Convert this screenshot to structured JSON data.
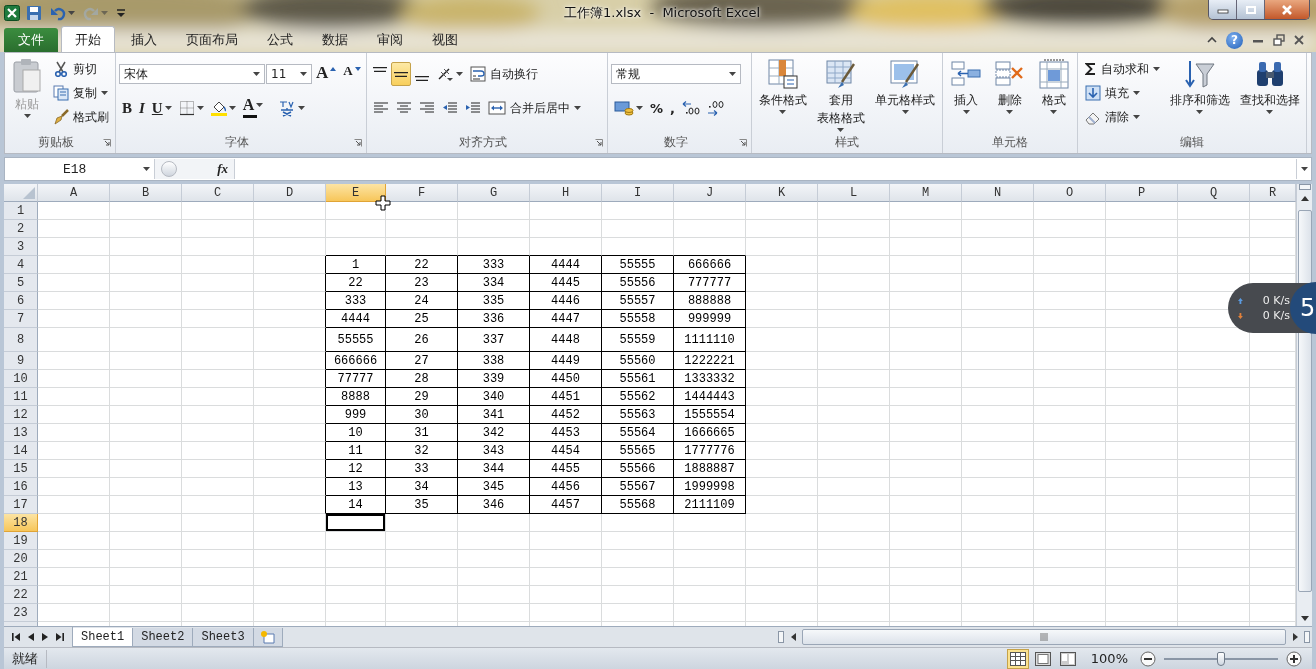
{
  "window": {
    "title": "工作簿1.xlsx  -  Microsoft Excel"
  },
  "quick_access": [
    {
      "disabled": false,
      "dropdown": false
    },
    {
      "disabled": false,
      "dropdown": true
    },
    {
      "disabled": true,
      "dropdown": true
    },
    {
      "disabled": false,
      "dropdown": false
    }
  ],
  "ribbon": {
    "tabs": [
      {
        "label": "文件",
        "kind": "backstage",
        "selected": false
      },
      {
        "label": "开始",
        "kind": "tab",
        "selected": true
      },
      {
        "label": "插入",
        "kind": "tab",
        "selected": false
      },
      {
        "label": "页面布局",
        "kind": "tab",
        "selected": false
      },
      {
        "label": "公式",
        "kind": "tab",
        "selected": false
      },
      {
        "label": "数据",
        "kind": "tab",
        "selected": false
      },
      {
        "label": "审阅",
        "kind": "tab",
        "selected": false
      },
      {
        "label": "视图",
        "kind": "tab",
        "selected": false
      }
    ],
    "help": "?",
    "groups": [
      {
        "title": "剪贴板",
        "launcher": true,
        "items": [
          {
            "kind": "large",
            "lines": [
              "粘贴"
            ],
            "disabled": true,
            "dropdown": true
          },
          {
            "kind": "column",
            "items": [
              {
                "label": "剪切",
                "dropdown": false
              },
              {
                "label": "复制",
                "dropdown": true
              },
              {
                "label": "格式刷",
                "dropdown": false
              }
            ]
          }
        ]
      },
      {
        "title": "字体",
        "launcher": true,
        "items": [
          {
            "kind": "toolbar",
            "upper": [
              {
                "kind": "combo",
                "value": "宋体"
              },
              {
                "kind": "combo",
                "value": "11"
              },
              {
                "kind": "glyph",
                "label": "A",
                "dropdown": false,
                "selected": false
              },
              {
                "kind": "glyph",
                "label": "A",
                "dropdown": false,
                "selected": false
              }
            ],
            "lower": [
              {
                "kind": "glyph",
                "label": "B",
                "dropdown": false,
                "selected": false
              },
              {
                "kind": "glyph",
                "label": "I",
                "dropdown": false,
                "selected": false
              },
              {
                "kind": "glyph",
                "label": "U",
                "dropdown": true,
                "selected": false
              },
              {
                "kind": "icon",
                "dropdown": true,
                "selected": false
              },
              {
                "kind": "icon",
                "dropdown": true,
                "selected": false
              },
              {
                "kind": "glyph",
                "label": "A",
                "dropdown": true,
                "selected": false
              },
              {
                "kind": "icon",
                "dropdown": true,
                "selected": false
              }
            ]
          }
        ]
      },
      {
        "title": "对齐方式",
        "launcher": true,
        "items": [
          {
            "kind": "toolbar",
            "upper": [
              {
                "kind": "icon",
                "dropdown": false,
                "selected": false
              },
              {
                "kind": "icon",
                "dropdown": false,
                "selected": true
              },
              {
                "kind": "icon",
                "dropdown": false,
                "selected": false
              },
              {
                "kind": "icon",
                "dropdown": true,
                "selected": false
              },
              {
                "kind": "labeled",
                "label": "自动换行",
                "dropdown": false
              }
            ],
            "lower": [
              {
                "kind": "icon",
                "dropdown": false,
                "selected": false
              },
              {
                "kind": "icon",
                "dropdown": false,
                "selected": false
              },
              {
                "kind": "icon",
                "dropdown": false,
                "selected": false
              },
              {
                "kind": "icon",
                "dropdown": false,
                "selected": false
              },
              {
                "kind": "icon",
                "dropdown": false,
                "selected": false
              },
              {
                "kind": "labeled",
                "label": "合并后居中",
                "dropdown": true
              }
            ]
          }
        ]
      },
      {
        "title": "数字",
        "launcher": true,
        "items": [
          {
            "kind": "toolbar",
            "upper": [
              {
                "kind": "combo",
                "value": "常规"
              }
            ],
            "lower": [
              {
                "kind": "icon",
                "dropdown": true,
                "selected": false
              },
              {
                "kind": "glyph",
                "label": "%",
                "dropdown": false,
                "selected": false
              },
              {
                "kind": "glyph",
                "label": ",",
                "dropdown": false,
                "selected": false
              },
              {
                "kind": "icon",
                "dropdown": false,
                "selected": false
              },
              {
                "kind": "icon",
                "dropdown": false,
                "selected": false
              }
            ]
          }
        ]
      },
      {
        "title": "样式",
        "launcher": false,
        "items": [
          {
            "kind": "large",
            "lines": [
              "条件格式"
            ],
            "disabled": false,
            "dropdown": true
          },
          {
            "kind": "large",
            "lines": [
              "套用",
              "表格格式"
            ],
            "disabled": false,
            "dropdown": true
          },
          {
            "kind": "large",
            "lines": [
              "单元格样式"
            ],
            "disabled": false,
            "dropdown": true
          }
        ]
      },
      {
        "title": "单元格",
        "launcher": false,
        "items": [
          {
            "kind": "large",
            "lines": [
              "插入"
            ],
            "disabled": false,
            "dropdown": true
          },
          {
            "kind": "large",
            "lines": [
              "删除"
            ],
            "disabled": false,
            "dropdown": true
          },
          {
            "kind": "large",
            "lines": [
              "格式"
            ],
            "disabled": false,
            "dropdown": true
          }
        ]
      },
      {
        "title": "编辑",
        "launcher": false,
        "items": [
          {
            "kind": "column",
            "items": [
              {
                "label": "自动求和",
                "dropdown": true
              },
              {
                "label": "填充",
                "dropdown": true
              },
              {
                "label": "清除",
                "dropdown": true
              }
            ]
          },
          {
            "kind": "large",
            "lines": [
              "排序和筛选"
            ],
            "disabled": false,
            "dropdown": true
          },
          {
            "kind": "large",
            "lines": [
              "查找和选择"
            ],
            "disabled": false,
            "dropdown": true
          }
        ]
      }
    ]
  },
  "formula_bar": {
    "name_box": "E18",
    "function_label": "fx"
  },
  "sheet": {
    "columns": [
      {
        "label": "A",
        "selected": false
      },
      {
        "label": "B",
        "selected": false
      },
      {
        "label": "C",
        "selected": false
      },
      {
        "label": "D",
        "selected": false
      },
      {
        "label": "E",
        "selected": true
      },
      {
        "label": "F",
        "selected": false
      },
      {
        "label": "G",
        "selected": false
      },
      {
        "label": "H",
        "selected": false
      },
      {
        "label": "I",
        "selected": false
      },
      {
        "label": "J",
        "selected": false
      },
      {
        "label": "K",
        "selected": false
      },
      {
        "label": "L",
        "selected": false
      },
      {
        "label": "M",
        "selected": false
      },
      {
        "label": "N",
        "selected": false
      },
      {
        "label": "O",
        "selected": false
      },
      {
        "label": "P",
        "selected": false
      },
      {
        "label": "Q",
        "selected": false
      },
      {
        "label": "R",
        "selected": false
      }
    ],
    "rows": [
      {
        "label": "1",
        "selected": false
      },
      {
        "label": "2",
        "selected": false
      },
      {
        "label": "3",
        "selected": false
      },
      {
        "label": "4",
        "selected": false
      },
      {
        "label": "5",
        "selected": false
      },
      {
        "label": "6",
        "selected": false
      },
      {
        "label": "7",
        "selected": false
      },
      {
        "label": "8",
        "selected": false
      },
      {
        "label": "9",
        "selected": false
      },
      {
        "label": "10",
        "selected": false
      },
      {
        "label": "11",
        "selected": false
      },
      {
        "label": "12",
        "selected": false
      },
      {
        "label": "13",
        "selected": false
      },
      {
        "label": "14",
        "selected": false
      },
      {
        "label": "15",
        "selected": false
      },
      {
        "label": "16",
        "selected": false
      },
      {
        "label": "17",
        "selected": false
      },
      {
        "label": "18",
        "selected": true
      },
      {
        "label": "19",
        "selected": false
      },
      {
        "label": "20",
        "selected": false
      },
      {
        "label": "21",
        "selected": false
      },
      {
        "label": "22",
        "selected": false
      },
      {
        "label": "23",
        "selected": false
      }
    ],
    "table": {
      "rows": [
        [
          "1",
          "22",
          "333",
          "4444",
          "55555",
          "666666"
        ],
        [
          "22",
          "23",
          "334",
          "4445",
          "55556",
          "777777"
        ],
        [
          "333",
          "24",
          "335",
          "4446",
          "55557",
          "888888"
        ],
        [
          "4444",
          "25",
          "336",
          "4447",
          "55558",
          "999999"
        ],
        [
          "55555",
          "26",
          "337",
          "4448",
          "55559",
          "1111110"
        ],
        [
          "666666",
          "27",
          "338",
          "4449",
          "55560",
          "1222221"
        ],
        [
          "77777",
          "28",
          "339",
          "4450",
          "55561",
          "1333332"
        ],
        [
          "8888",
          "29",
          "340",
          "4451",
          "55562",
          "1444443"
        ],
        [
          "999",
          "30",
          "341",
          "4452",
          "55563",
          "1555554"
        ],
        [
          "10",
          "31",
          "342",
          "4453",
          "55564",
          "1666665"
        ],
        [
          "11",
          "32",
          "343",
          "4454",
          "55565",
          "1777776"
        ],
        [
          "12",
          "33",
          "344",
          "4455",
          "55566",
          "1888887"
        ],
        [
          "13",
          "34",
          "345",
          "4456",
          "55567",
          "1999998"
        ],
        [
          "14",
          "35",
          "346",
          "4457",
          "55568",
          "2111109"
        ]
      ]
    }
  },
  "sheet_tabs": [
    {
      "label": "Sheet1",
      "selected": true
    },
    {
      "label": "Sheet2",
      "selected": false
    },
    {
      "label": "Sheet3",
      "selected": false
    }
  ],
  "status_bar": {
    "status": "就绪",
    "views": [
      {
        "selected": true
      },
      {
        "selected": false
      },
      {
        "selected": false
      }
    ],
    "zoom": "100%",
    "zoom_slider": {
      "level": 0.5
    }
  },
  "net_widget": {
    "upload": "0 K/s",
    "download": "0 K/s",
    "badge": "5"
  }
}
